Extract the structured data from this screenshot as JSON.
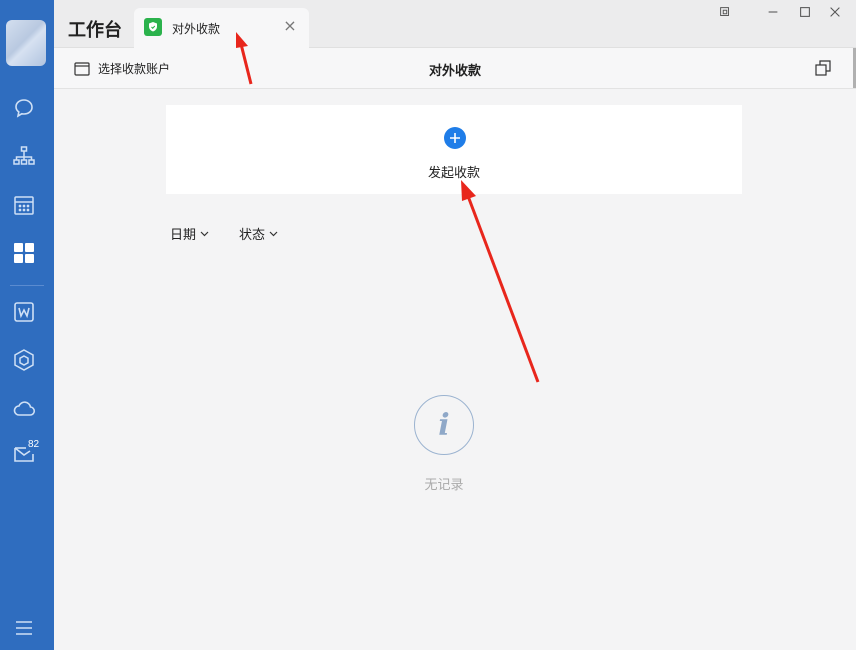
{
  "topbar": {
    "app_title": "工作台",
    "tab": {
      "label": "对外收款",
      "icon": "shield-icon",
      "close_glyph": "×"
    }
  },
  "header": {
    "select_account": "选择收款账户",
    "page_title": "对外收款"
  },
  "card": {
    "label": "发起收款"
  },
  "filters": {
    "date": "日期",
    "status": "状态"
  },
  "empty": {
    "text": "无记录"
  },
  "sidebar": {
    "icons": [
      "chat-icon",
      "org-chart-icon",
      "calendar-icon",
      "workbench-grid-icon",
      "document-w-icon",
      "cube-icon",
      "cloud-icon",
      "mail-icon",
      "menu-icon"
    ],
    "mail_badge": "82"
  },
  "colors": {
    "sidebar": "#2f6dbf",
    "accent": "#1f7de8",
    "tab_icon": "#2bb24c",
    "arrow": "#e8261c"
  }
}
